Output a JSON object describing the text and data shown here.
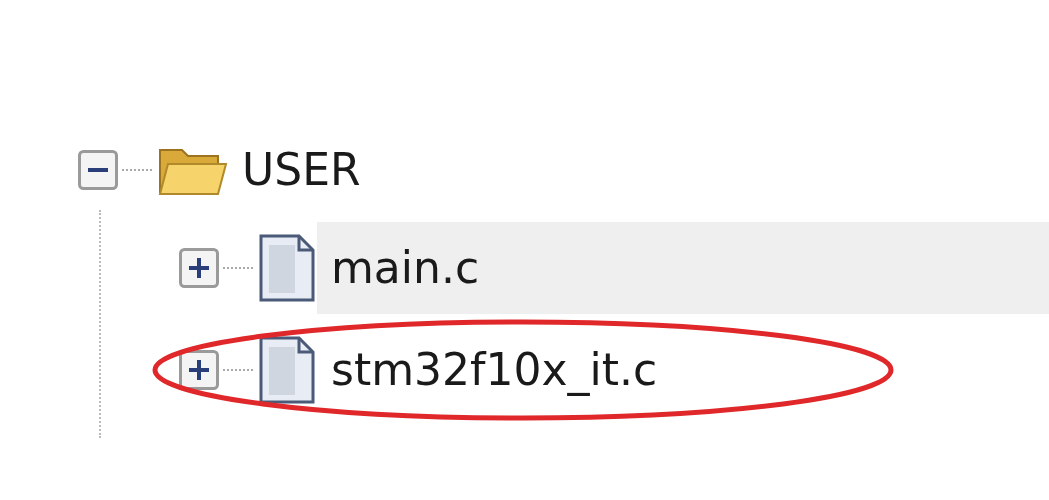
{
  "tree": [
    {
      "label": "USER",
      "kind": "folder",
      "expanded": true,
      "children": [
        {
          "label": "main.c",
          "kind": "file",
          "expanded": false,
          "selected": true,
          "annotated": false
        },
        {
          "label": "stm32f10x_it.c",
          "kind": "file",
          "expanded": false,
          "selected": false,
          "annotated": true
        }
      ]
    }
  ]
}
